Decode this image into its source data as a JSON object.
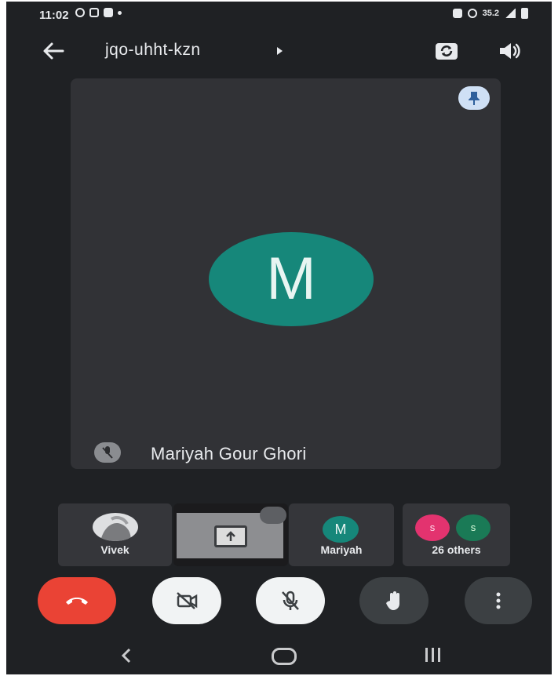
{
  "status_bar": {
    "time": "11:02",
    "right_text": "35.2"
  },
  "top_bar": {
    "meeting_code": "jqo-uhht-kzn"
  },
  "main_tile": {
    "avatar_letter": "M",
    "participant_name": "Mariyah Gour Ghori",
    "avatar_color": "#16877a"
  },
  "filmstrip": {
    "tiles": [
      {
        "label": "Vivek"
      },
      {
        "label": ""
      },
      {
        "label": "Mariyah",
        "avatar_letter": "M"
      },
      {
        "label": "26 others",
        "avatar_letters": [
          "s",
          "s"
        ]
      }
    ]
  },
  "controls": {
    "end_call_color": "#ea4335",
    "icons": [
      "end-call-icon",
      "camera-off-icon",
      "mic-off-icon",
      "raise-hand-icon",
      "more-options-icon"
    ]
  },
  "nav_bar": {
    "back_glyph": "<"
  }
}
